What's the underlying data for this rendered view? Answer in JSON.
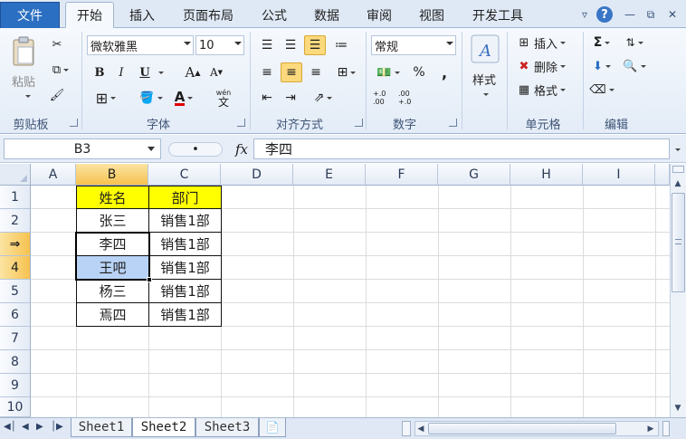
{
  "tabs": {
    "file": "文件",
    "items": [
      "开始",
      "插入",
      "页面布局",
      "公式",
      "数据",
      "审阅",
      "视图",
      "开发工具"
    ],
    "active": "开始"
  },
  "ribbon": {
    "clipboard": {
      "label": "剪贴板",
      "paste": "粘贴"
    },
    "font": {
      "label": "字体",
      "name": "微软雅黑",
      "size": "10",
      "bold": "B",
      "italic": "I",
      "underline": "U",
      "grow": "A",
      "shrink": "A",
      "color_letter": "A",
      "wen": "wén",
      "wen_char": "文",
      "color_accent": "#e00000"
    },
    "alignment": {
      "label": "对齐方式"
    },
    "number": {
      "label": "数字",
      "format": "常规",
      "percent": "%",
      "comma": ",",
      "inc": "+.0 .00",
      "dec": ".00 +.0"
    },
    "styles": {
      "label": "样式"
    },
    "cells": {
      "label": "单元格",
      "insert": "插入",
      "delete": "删除",
      "format": "格式"
    },
    "editing": {
      "label": "编辑",
      "sum": "Σ"
    }
  },
  "formula_bar": {
    "name_box": "B3",
    "fx": "fx",
    "value": "李四"
  },
  "grid": {
    "columns": [
      "A",
      "B",
      "C",
      "D",
      "E",
      "F",
      "G",
      "H",
      "I"
    ],
    "rows": [
      "1",
      "2",
      "3",
      "4",
      "5",
      "6",
      "7",
      "8",
      "9",
      "10"
    ],
    "row3_marker": "⇒",
    "table": {
      "header": [
        "姓名",
        "部门"
      ],
      "rows": [
        [
          "张三",
          "销售1部"
        ],
        [
          "李四",
          "销售1部"
        ],
        [
          "王吧",
          "销售1部"
        ],
        [
          "杨三",
          "销售1部"
        ],
        [
          "焉四",
          "销售1部"
        ]
      ]
    },
    "header_fill": "#ffff00",
    "selection_fill": "#b8d3f5"
  },
  "sheets": {
    "tabs": [
      "Sheet1",
      "Sheet2",
      "Sheet3"
    ],
    "active": "Sheet2"
  }
}
